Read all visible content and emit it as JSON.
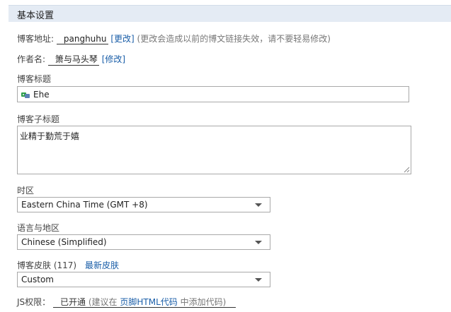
{
  "section": {
    "title": "基本设置"
  },
  "blog_address": {
    "label": "博客地址:",
    "value": "panghuhu",
    "change_link": "[更改]",
    "hint": "(更改会造成以前的博文链接失效，请不要轻易修改)"
  },
  "author": {
    "label": "作者名:",
    "value": "箫与马头琴",
    "edit_link": "[修改]"
  },
  "blog_title": {
    "label": "博客标题",
    "value": "Ehe"
  },
  "blog_subtitle": {
    "label": "博客子标题",
    "value": "业精于勤荒于嬉"
  },
  "timezone": {
    "label": "时区",
    "selected": "Eastern China Time (GMT +8)"
  },
  "language": {
    "label": "语言与地区",
    "selected": "Chinese (Simplified)"
  },
  "skin": {
    "label": "博客皮肤",
    "count": "(117)",
    "new_link": "最新皮肤",
    "selected": "Custom"
  },
  "js": {
    "label": "JS权限：",
    "status": "已开通",
    "hint_prefix": "(建议在",
    "hint_link": "页脚HTML代码",
    "hint_suffix": "中添加代码)"
  },
  "icons": {
    "title_icon": "mini-emoji-icon"
  },
  "colors": {
    "header_bg": "#e4ebf4",
    "link": "#1a5ea8"
  }
}
